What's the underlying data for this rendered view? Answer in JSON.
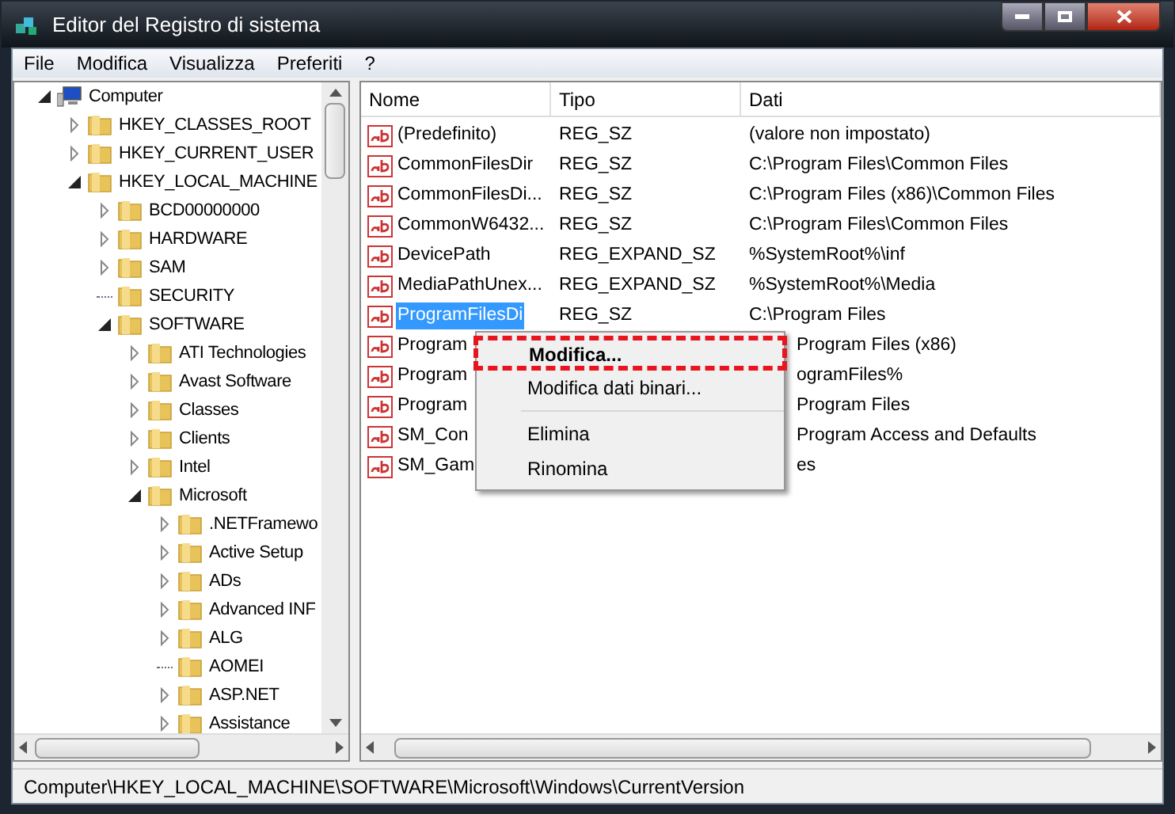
{
  "window": {
    "title": "Editor del Registro di sistema"
  },
  "menu_bar": [
    "File",
    "Modifica",
    "Visualizza",
    "Preferiti",
    "?"
  ],
  "tree": [
    {
      "label": "Computer",
      "kind": "computer",
      "expandable": true,
      "expanded": true,
      "children": [
        {
          "label": "HKEY_CLASSES_ROOT",
          "kind": "folder",
          "expandable": true,
          "expanded": false
        },
        {
          "label": "HKEY_CURRENT_USER",
          "kind": "folder",
          "expandable": true,
          "expanded": false
        },
        {
          "label": "HKEY_LOCAL_MACHINE",
          "kind": "folder",
          "expandable": true,
          "expanded": true,
          "children": [
            {
              "label": "BCD00000000",
              "kind": "folder",
              "expandable": true,
              "expanded": false
            },
            {
              "label": "HARDWARE",
              "kind": "folder",
              "expandable": true,
              "expanded": false
            },
            {
              "label": "SAM",
              "kind": "folder",
              "expandable": true,
              "expanded": false
            },
            {
              "label": "SECURITY",
              "kind": "folder",
              "expandable": false
            },
            {
              "label": "SOFTWARE",
              "kind": "folder",
              "expandable": true,
              "expanded": true,
              "children": [
                {
                  "label": "ATI Technologies",
                  "kind": "folder",
                  "expandable": true,
                  "expanded": false
                },
                {
                  "label": "Avast Software",
                  "kind": "folder",
                  "expandable": true,
                  "expanded": false
                },
                {
                  "label": "Classes",
                  "kind": "folder",
                  "expandable": true,
                  "expanded": false
                },
                {
                  "label": "Clients",
                  "kind": "folder",
                  "expandable": true,
                  "expanded": false
                },
                {
                  "label": "Intel",
                  "kind": "folder",
                  "expandable": true,
                  "expanded": false
                },
                {
                  "label": "Microsoft",
                  "kind": "folder",
                  "expandable": true,
                  "expanded": true,
                  "children": [
                    {
                      "label": ".NETFramewo",
                      "kind": "folder",
                      "expandable": true,
                      "expanded": false
                    },
                    {
                      "label": "Active Setup",
                      "kind": "folder",
                      "expandable": true,
                      "expanded": false
                    },
                    {
                      "label": "ADs",
                      "kind": "folder",
                      "expandable": true,
                      "expanded": false
                    },
                    {
                      "label": "Advanced INF",
                      "kind": "folder",
                      "expandable": true,
                      "expanded": false
                    },
                    {
                      "label": "ALG",
                      "kind": "folder",
                      "expandable": true,
                      "expanded": false
                    },
                    {
                      "label": "AOMEI",
                      "kind": "folder",
                      "expandable": false
                    },
                    {
                      "label": "ASP.NET",
                      "kind": "folder",
                      "expandable": true,
                      "expanded": false
                    },
                    {
                      "label": "Assistance",
                      "kind": "folder",
                      "expandable": true,
                      "expanded": false
                    }
                  ]
                }
              ]
            }
          ]
        }
      ]
    }
  ],
  "table": {
    "columns": [
      "Nome",
      "Tipo",
      "Dati"
    ],
    "rows": [
      {
        "name": "(Predefinito)",
        "type": "REG_SZ",
        "data": "(valore non impostato)",
        "selected": false
      },
      {
        "name": "CommonFilesDir",
        "type": "REG_SZ",
        "data": "C:\\Program Files\\Common Files",
        "selected": false
      },
      {
        "name": "CommonFilesDi...",
        "type": "REG_SZ",
        "data": "C:\\Program Files (x86)\\Common Files",
        "selected": false
      },
      {
        "name": "CommonW6432...",
        "type": "REG_SZ",
        "data": "C:\\Program Files\\Common Files",
        "selected": false
      },
      {
        "name": "DevicePath",
        "type": "REG_EXPAND_SZ",
        "data": "%SystemRoot%\\inf",
        "selected": false
      },
      {
        "name": "MediaPathUnex...",
        "type": "REG_EXPAND_SZ",
        "data": "%SystemRoot%\\Media",
        "selected": false
      },
      {
        "name": "ProgramFilesDi",
        "type": "REG_SZ",
        "data": "C:\\Program Files",
        "selected": true
      },
      {
        "name": "Program",
        "data": "Program Files (x86)",
        "selected": false
      },
      {
        "name": "Program",
        "data": "ogramFiles%",
        "selected": false
      },
      {
        "name": "Program",
        "data": "Program Files",
        "selected": false
      },
      {
        "name": "SM_Con",
        "data": "Program Access and Defaults",
        "selected": false
      },
      {
        "name": "SM_Gam",
        "data": "es",
        "selected": false
      }
    ]
  },
  "context_menu": [
    {
      "kind": "item",
      "label": "Modifica...",
      "default": true,
      "highlighted": true
    },
    {
      "kind": "item",
      "label": "Modifica dati binari...",
      "default": false,
      "highlighted": false
    },
    {
      "kind": "separator"
    },
    {
      "kind": "item",
      "label": "Elimina",
      "default": false,
      "highlighted": false
    },
    {
      "kind": "item",
      "label": "Rinomina",
      "default": false,
      "highlighted": false
    }
  ],
  "status_bar": "Computer\\HKEY_LOCAL_MACHINE\\SOFTWARE\\Microsoft\\Windows\\CurrentVersion"
}
